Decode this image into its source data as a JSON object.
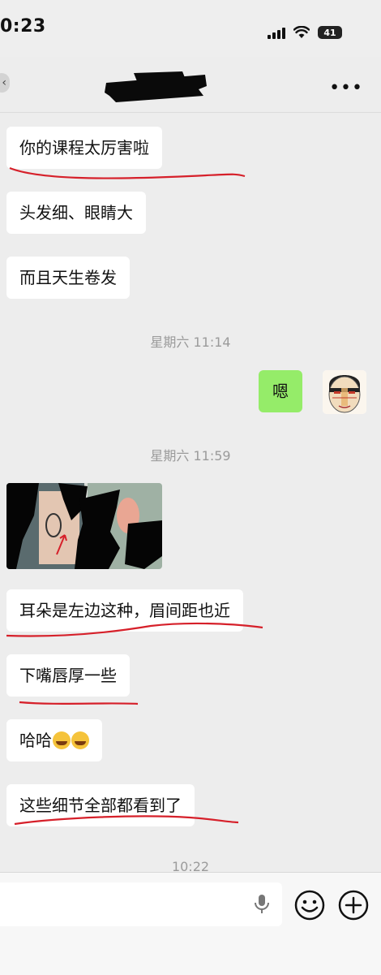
{
  "status_bar": {
    "time": "0:23",
    "battery": "41"
  },
  "nav": {
    "more": "•••"
  },
  "messages": [
    {
      "text": "你的课程太厉害啦"
    },
    {
      "text": "头发细、眼睛大"
    },
    {
      "text": "而且天生卷发"
    },
    {
      "timestamp": "星期六 11:14"
    },
    {
      "text": "嗯"
    },
    {
      "timestamp": "星期六 11:59"
    },
    {
      "text": "耳朵是左边这种，眉间距也近"
    },
    {
      "text": "下嘴唇厚一些"
    },
    {
      "text": "哈哈"
    },
    {
      "text": "这些细节全部都看到了"
    },
    {
      "timestamp": "10:22"
    }
  ],
  "colors": {
    "background": "#ededed",
    "incoming_bubble": "#ffffff",
    "outgoing_bubble": "#95ec69",
    "annotation": "#d6202a"
  }
}
